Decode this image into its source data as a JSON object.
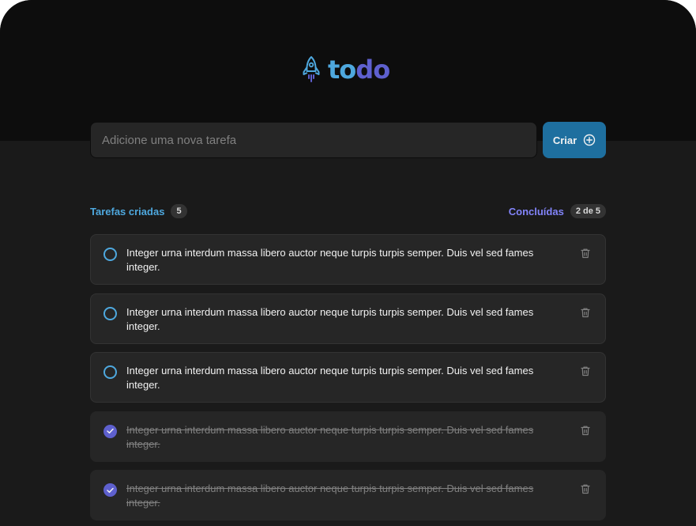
{
  "brand": {
    "part1": "to",
    "part2": "do",
    "icon": "rocket-icon",
    "color1": "#4ea8de",
    "color2": "#5e60ce"
  },
  "new_task": {
    "placeholder": "Adicione uma nova tarefa",
    "value": "",
    "create_label": "Criar",
    "create_icon": "plus-circle-icon"
  },
  "summary": {
    "created_label": "Tarefas criadas",
    "created_count": "5",
    "done_label": "Concluídas",
    "done_count": "2 de 5"
  },
  "tasks": [
    {
      "text": "Integer urna interdum massa libero auctor neque turpis turpis semper. Duis vel sed fames integer.",
      "done": false
    },
    {
      "text": "Integer urna interdum massa libero auctor neque turpis turpis semper. Duis vel sed fames integer.",
      "done": false
    },
    {
      "text": "Integer urna interdum massa libero auctor neque turpis turpis semper. Duis vel sed fames integer.",
      "done": false
    },
    {
      "text": "Integer urna interdum massa libero auctor neque turpis turpis semper. Duis vel sed fames integer.",
      "done": true
    },
    {
      "text": "Integer urna interdum massa libero auctor neque turpis turpis semper. Duis vel sed fames integer.",
      "done": true
    }
  ],
  "colors": {
    "accent": "#1e6f9f",
    "blue": "#4ea8de",
    "purple": "#5e60ce",
    "purple_light": "#8284fa"
  }
}
